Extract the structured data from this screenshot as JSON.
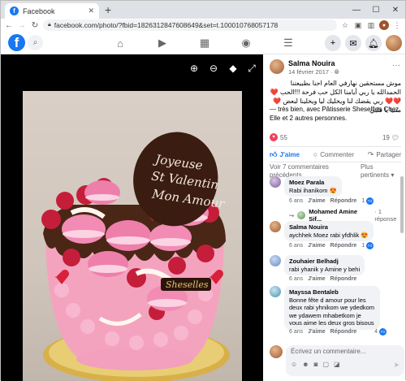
{
  "browser": {
    "tab_title": "Facebook",
    "tab_favicon": "f",
    "url": "facebook.com/photo/?fbid=1826312847608649&set=t.100010768057178",
    "controls": {
      "minimize": "—",
      "maximize": "☐",
      "close": "✕"
    },
    "toolbar_icons": [
      "star-icon",
      "extensions-icon",
      "sidebar-icon",
      "profile-icon",
      "menu-icon"
    ]
  },
  "fb": {
    "logo": "f",
    "nav_icons": [
      "home-icon",
      "video-icon",
      "marketplace-icon",
      "groups-icon",
      "menu-icon"
    ],
    "right_buttons": [
      "plus-icon",
      "messenger-icon",
      "notifications-icon"
    ]
  },
  "photo": {
    "cake_plaque": "Joyeuse St Valentin Mon Amour",
    "cake_brand": "Sheselles"
  },
  "post": {
    "author": "Salma Nouira",
    "date": "14 février 2017 · ",
    "text_ar": "موش مستحقين نهارفي العام احنا بطبيعتنا الحمدالله يا ربي أيامنا الكل حب فرحة !!!الحب ❤️❤️❤️ ربي يقضك لنا ويخليك ليا ويخلينا لبعض ❤️ متنيا يا قلبي",
    "text_fr": "— très bien, avec Pâtisserie Shesellles Chez Elle et 2 autres personnes.",
    "reactions_count": "55",
    "comments_count": "19",
    "actions": {
      "like": "J'aime",
      "comment": "Commenter",
      "share": "Partager"
    },
    "view_prev": "Voir 7 commentaires précédents",
    "sort": "Plus pertinents ▾"
  },
  "comments": [
    {
      "name": "Moez Parala",
      "text": "Rabi ihanikom 😍",
      "time": "6 ans",
      "like": "J'aime",
      "reply": "Répondre",
      "count": "1"
    },
    {
      "reply_line_name": "Mohamed Amine Sif...",
      "reply_line_rest": "· 1 réponse"
    },
    {
      "name": "Salma Nouira",
      "text": "aychhek Moez rabi yfdhlik 😍",
      "time": "6 ans",
      "like": "J'aime",
      "reply": "Répondre",
      "count": "1"
    },
    {
      "name": "Zouhaier Belhadj",
      "text": "rabi yhanik y Amine y behi",
      "time": "6 ans",
      "like": "J'aime",
      "reply": "Répondre"
    },
    {
      "name": "Mayssa Bentaleb",
      "text": "Bonne fête d amour pour les deux rabi yhnikom we ydedkom we ydawem mhabetkom je vous aime les deux gros bisous",
      "time": "6 ans",
      "like": "J'aime",
      "reply": "Répondre",
      "count": "4"
    }
  ],
  "composer": {
    "placeholder": "Écrivez un commentaire..."
  }
}
